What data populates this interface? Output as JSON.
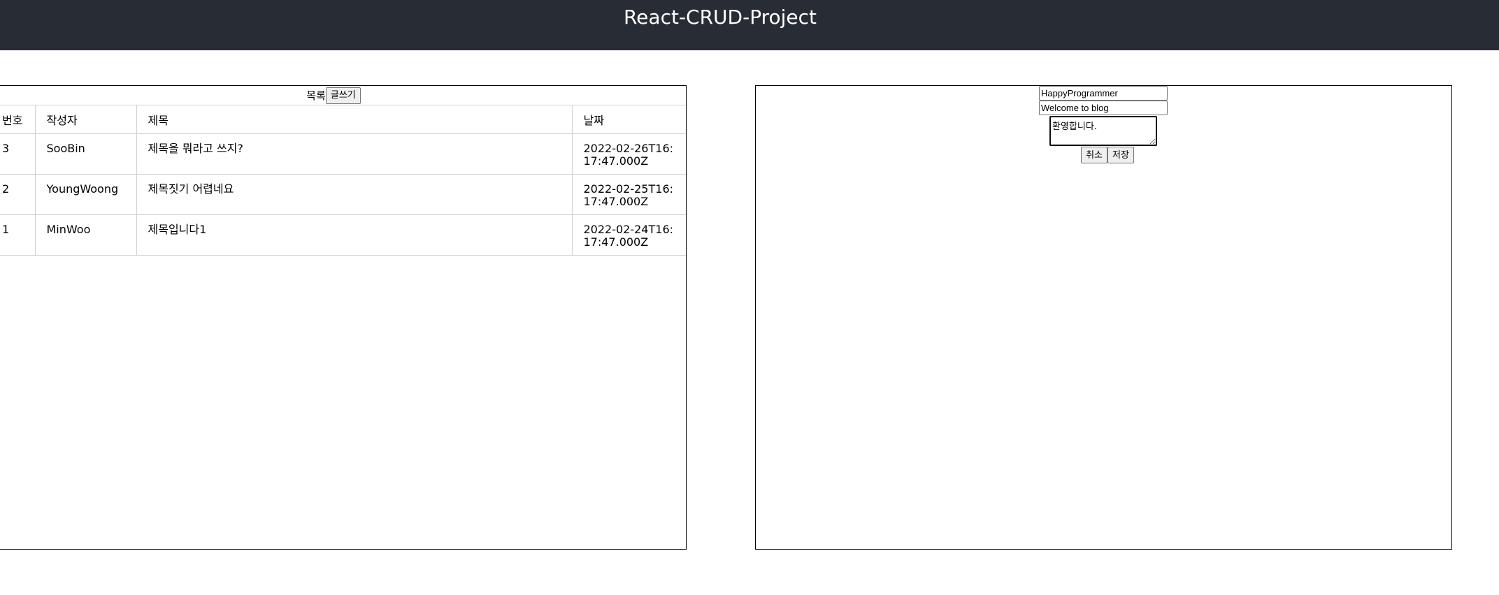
{
  "header": {
    "title": "React-CRUD-Project",
    "background_color": "#282c34"
  },
  "list": {
    "heading": "목록",
    "write_button_label": "글쓰기",
    "columns": [
      "번호",
      "작성자",
      "제목",
      "날짜"
    ],
    "rows": [
      {
        "no": "3",
        "writer": "SooBin",
        "title": "제목을 뭐라고 쓰지?",
        "date": "2022-02-26T16:17:47.000Z"
      },
      {
        "no": "2",
        "writer": "YoungWoong",
        "title": "제목짓기 어렵네요",
        "date": "2022-02-25T16:17:47.000Z"
      },
      {
        "no": "1",
        "writer": "MinWoo",
        "title": "제목입니다1",
        "date": "2022-02-24T16:17:47.000Z"
      }
    ]
  },
  "edit": {
    "writer_value": "HappyProgrammer",
    "title_value": "Welcome to blog",
    "content_value": "환영합니다.",
    "cancel_label": "취소",
    "save_label": "저장"
  }
}
